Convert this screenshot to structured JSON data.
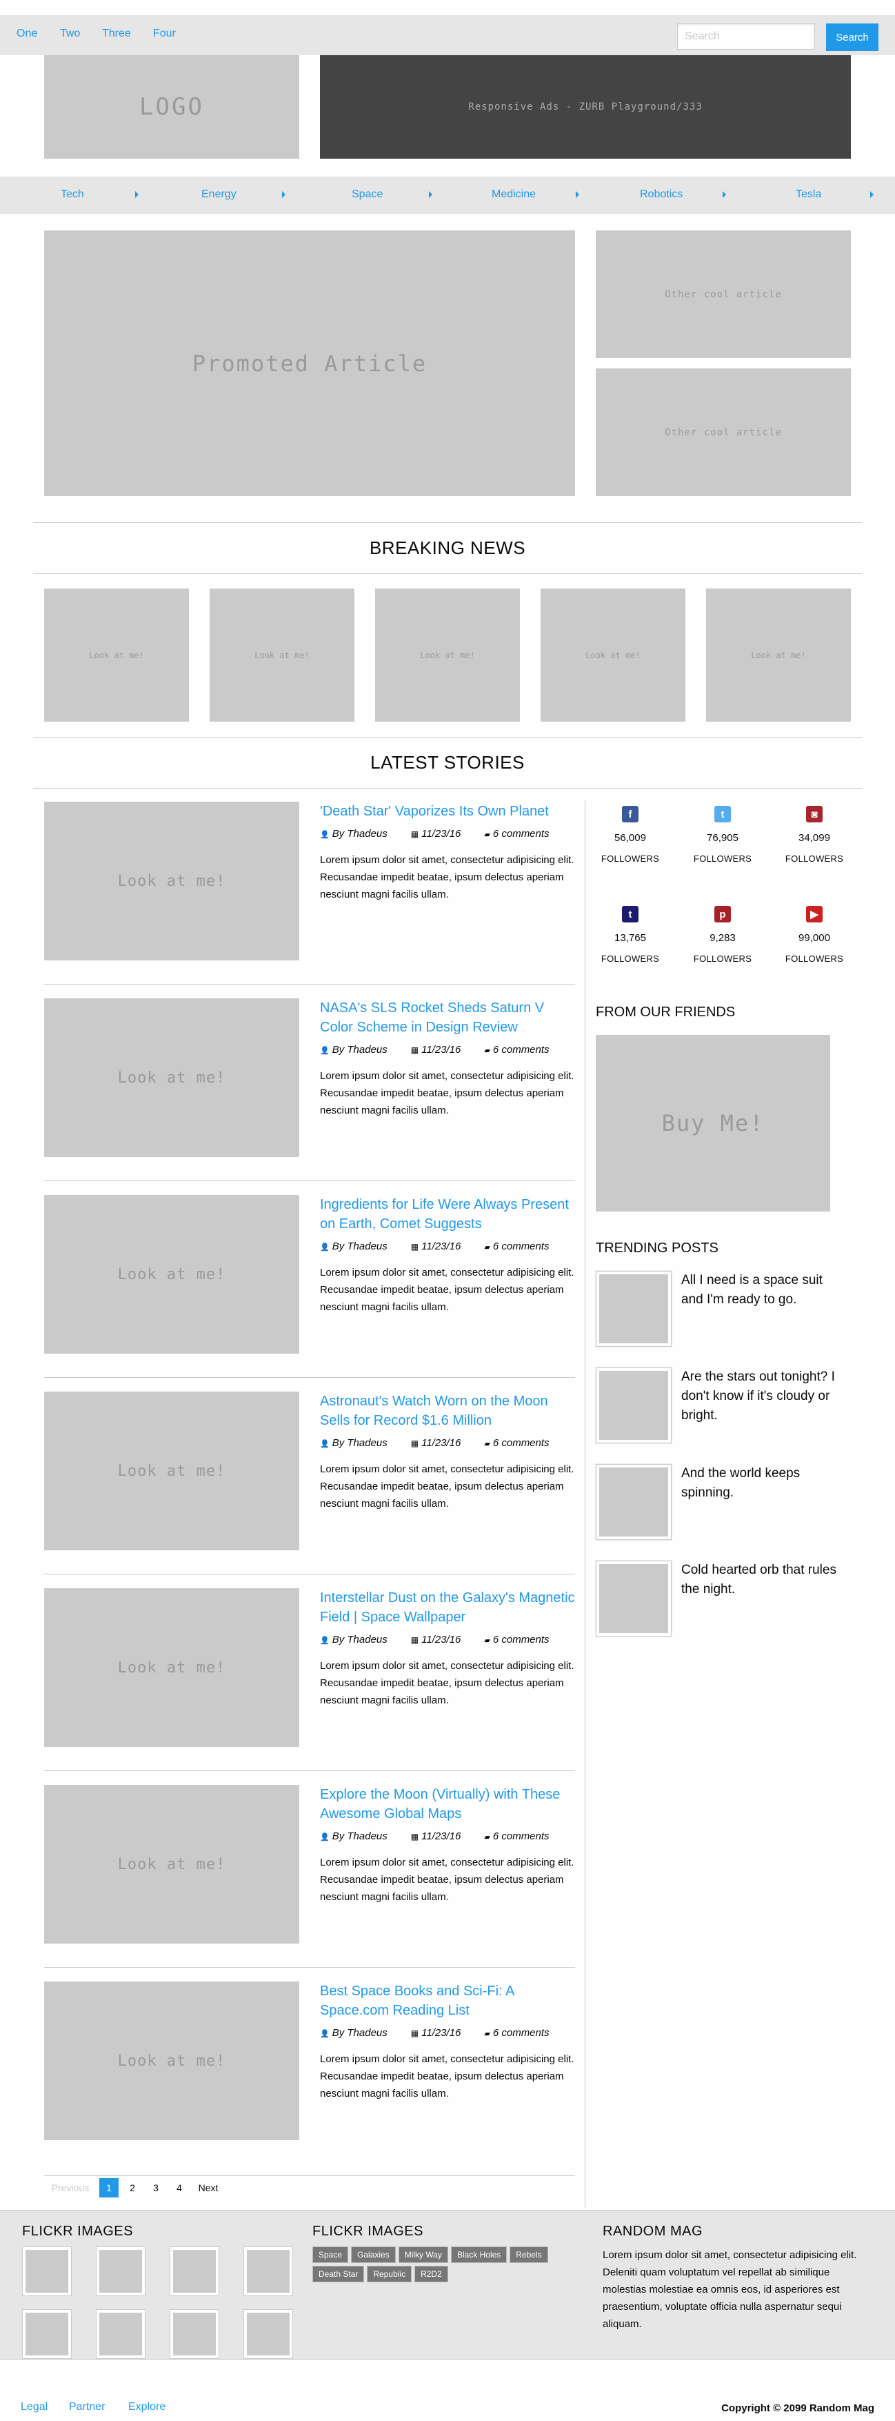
{
  "topbar": {
    "nav": [
      "One",
      "Two",
      "Three",
      "Four"
    ],
    "search_placeholder": "Search",
    "search_button": "Search"
  },
  "header": {
    "logo": "LOGO",
    "ad": "Responsive Ads - ZURB Playground/333"
  },
  "categories": [
    "Tech",
    "Energy",
    "Space",
    "Medicine",
    "Robotics",
    "Tesla"
  ],
  "hero": {
    "promoted": "Promoted Article",
    "side": [
      "Other cool article",
      "Other cool article"
    ]
  },
  "breaking": {
    "title": "BREAKING NEWS",
    "items": [
      "Look at me!",
      "Look at me!",
      "Look at me!",
      "Look at me!",
      "Look at me!"
    ]
  },
  "latest": {
    "title": "LATEST STORIES",
    "image_label": "Look at me!",
    "stories": [
      {
        "title": "'Death Star' Vaporizes Its Own Planet",
        "author": "By Thadeus",
        "date": "11/23/16",
        "comments": "6 comments",
        "body": "Lorem ipsum dolor sit amet, consectetur adipisicing elit. Recusandae impedit beatae, ipsum delectus aperiam nesciunt magni facilis ullam."
      },
      {
        "title": "NASA's SLS Rocket Sheds Saturn V Color Scheme in Design Review",
        "author": "By Thadeus",
        "date": "11/23/16",
        "comments": "6 comments",
        "body": "Lorem ipsum dolor sit amet, consectetur adipisicing elit. Recusandae impedit beatae, ipsum delectus aperiam nesciunt magni facilis ullam."
      },
      {
        "title": "Ingredients for Life Were Always Present on Earth, Comet Suggests",
        "author": "By Thadeus",
        "date": "11/23/16",
        "comments": "6 comments",
        "body": "Lorem ipsum dolor sit amet, consectetur adipisicing elit. Recusandae impedit beatae, ipsum delectus aperiam nesciunt magni facilis ullam."
      },
      {
        "title": "Astronaut's Watch Worn on the Moon Sells for Record $1.6 Million",
        "author": "By Thadeus",
        "date": "11/23/16",
        "comments": "6 comments",
        "body": "Lorem ipsum dolor sit amet, consectetur adipisicing elit. Recusandae impedit beatae, ipsum delectus aperiam nesciunt magni facilis ullam."
      },
      {
        "title": "Interstellar Dust on the Galaxy's Magnetic Field | Space Wallpaper",
        "author": "By Thadeus",
        "date": "11/23/16",
        "comments": "6 comments",
        "body": "Lorem ipsum dolor sit amet, consectetur adipisicing elit. Recusandae impedit beatae, ipsum delectus aperiam nesciunt magni facilis ullam."
      },
      {
        "title": "Explore the Moon (Virtually) with These Awesome Global Maps",
        "author": "By Thadeus",
        "date": "11/23/16",
        "comments": "6 comments",
        "body": "Lorem ipsum dolor sit amet, consectetur adipisicing elit. Recusandae impedit beatae, ipsum delectus aperiam nesciunt magni facilis ullam."
      },
      {
        "title": "Best Space Books and Sci-Fi: A Space.com Reading List",
        "author": "By Thadeus",
        "date": "11/23/16",
        "comments": "6 comments",
        "body": "Lorem ipsum dolor sit amet, consectetur adipisicing elit. Recusandae impedit beatae, ipsum delectus aperiam nesciunt magni facilis ullam."
      }
    ]
  },
  "social": [
    {
      "icon": "facebook-icon",
      "glyph": "f",
      "color": "#3b5998",
      "count": "56,009",
      "label": "FOLLOWERS"
    },
    {
      "icon": "twitter-icon",
      "glyph": "t",
      "color": "#55acee",
      "count": "76,905",
      "label": "FOLLOWERS"
    },
    {
      "icon": "instagram-icon",
      "glyph": "◙",
      "color": "#a5262d",
      "count": "34,099",
      "label": "FOLLOWERS"
    },
    {
      "icon": "tumblr-icon",
      "glyph": "t",
      "color": "#1c1a6b",
      "count": "13,765",
      "label": "FOLLOWERS"
    },
    {
      "icon": "pinterest-icon",
      "glyph": "p",
      "color": "#a8202a",
      "count": "9,283",
      "label": "FOLLOWERS"
    },
    {
      "icon": "youtube-icon",
      "glyph": "▶",
      "color": "#cd2020",
      "count": "99,000",
      "label": "FOLLOWERS"
    }
  ],
  "sidebar": {
    "friends_title": "FROM OUR FRIENDS",
    "ad_label": "Buy Me!",
    "trending_title": "TRENDING POSTS",
    "trending": [
      "All I need is a space suit and I'm ready to go.",
      "Are the stars out tonight? I don't know if it's cloudy or bright.",
      "And the world keeps spinning.",
      "Cold hearted orb that rules the night."
    ]
  },
  "pagination": {
    "previous": "Previous",
    "pages": [
      "1",
      "2",
      "3",
      "4"
    ],
    "next": "Next",
    "current": "1"
  },
  "footer": {
    "flickr_title_1": "FLICKR IMAGES",
    "flickr_title_2": "FLICKR IMAGES",
    "tags": [
      "Space",
      "Galaxies",
      "Milky Way",
      "Black Holes",
      "Rebels",
      "Death Star",
      "Republic",
      "R2D2"
    ],
    "random_title": "RANDOM MAG",
    "random_text": "Lorem ipsum dolor sit amet, consectetur adipisicing elit. Deleniti quam voluptatum vel repellat ab similique molestias molestiae ea omnis eos, id asperiores est praesentium, voluptate officia nulla aspernatur sequi aliquam."
  },
  "bottom": {
    "links": [
      "Legal",
      "Partner",
      "Explore"
    ],
    "copyright": "Copyright © 2099 Random Mag"
  },
  "colors": {
    "accent": "#2199e8",
    "placeholder": "#cacaca",
    "bar": "#e6e6e6"
  }
}
